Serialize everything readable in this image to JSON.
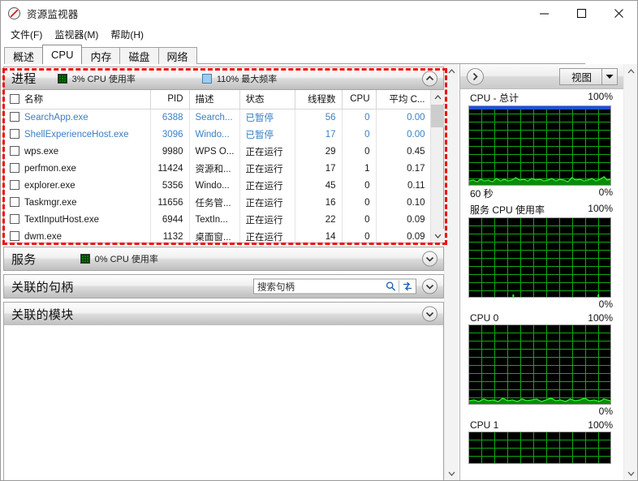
{
  "window": {
    "title": "资源监视器",
    "icon": "resource-monitor-icon",
    "minimize": "—",
    "maximize": "□",
    "close": "✕"
  },
  "menubar": {
    "items": [
      {
        "label": "文件(F)"
      },
      {
        "label": "监视器(M)"
      },
      {
        "label": "帮助(H)"
      }
    ]
  },
  "tabs": [
    {
      "label": "概述",
      "active": false
    },
    {
      "label": "CPU",
      "active": true
    },
    {
      "label": "内存",
      "active": false
    },
    {
      "label": "磁盘",
      "active": false
    },
    {
      "label": "网络",
      "active": false
    }
  ],
  "process_section": {
    "title": "进程",
    "legend_cpu": "3% CPU 使用率",
    "legend_freq": "110% 最大频率",
    "collapse_icon": "chevron-up-icon",
    "columns": [
      {
        "key": "name",
        "label": "名称",
        "align": "left"
      },
      {
        "key": "pid",
        "label": "PID",
        "align": "right"
      },
      {
        "key": "desc",
        "label": "描述",
        "align": "left"
      },
      {
        "key": "status",
        "label": "状态",
        "align": "left",
        "sorted": true,
        "sort_dir": "asc"
      },
      {
        "key": "threads",
        "label": "线程数",
        "align": "right"
      },
      {
        "key": "cpu",
        "label": "CPU",
        "align": "right"
      },
      {
        "key": "avgcpu",
        "label": "平均 C...",
        "align": "right"
      }
    ],
    "rows": [
      {
        "name": "SearchApp.exe",
        "pid": "6388",
        "desc": "Search...",
        "status": "已暂停",
        "threads": "56",
        "cpu": "0",
        "avgcpu": "0.00",
        "suspended": true
      },
      {
        "name": "ShellExperienceHost.exe",
        "pid": "3096",
        "desc": "Windo...",
        "status": "已暂停",
        "threads": "17",
        "cpu": "0",
        "avgcpu": "0.00",
        "suspended": true
      },
      {
        "name": "wps.exe",
        "pid": "9980",
        "desc": "WPS O...",
        "status": "正在运行",
        "threads": "29",
        "cpu": "0",
        "avgcpu": "0.45",
        "suspended": false
      },
      {
        "name": "perfmon.exe",
        "pid": "11424",
        "desc": "资源和...",
        "status": "正在运行",
        "threads": "17",
        "cpu": "1",
        "avgcpu": "0.17",
        "suspended": false
      },
      {
        "name": "explorer.exe",
        "pid": "5356",
        "desc": "Windo...",
        "status": "正在运行",
        "threads": "45",
        "cpu": "0",
        "avgcpu": "0.11",
        "suspended": false
      },
      {
        "name": "Taskmgr.exe",
        "pid": "11656",
        "desc": "任务管...",
        "status": "正在运行",
        "threads": "16",
        "cpu": "0",
        "avgcpu": "0.10",
        "suspended": false
      },
      {
        "name": "TextInputHost.exe",
        "pid": "6944",
        "desc": "TextIn...",
        "status": "正在运行",
        "threads": "22",
        "cpu": "0",
        "avgcpu": "0.09",
        "suspended": false
      },
      {
        "name": "dwm.exe",
        "pid": "1132",
        "desc": "桌面窗...",
        "status": "正在运行",
        "threads": "14",
        "cpu": "0",
        "avgcpu": "0.09",
        "suspended": false
      }
    ]
  },
  "services_section": {
    "title": "服务",
    "legend_cpu": "0% CPU 使用率",
    "expand_icon": "chevron-down-icon"
  },
  "handles_section": {
    "title": "关联的句柄",
    "search_placeholder": "搜索句柄",
    "search_value": "",
    "search_icon": "magnifier-icon",
    "refresh_icon": "refresh-arrows-icon",
    "expand_icon": "chevron-down-icon"
  },
  "modules_section": {
    "title": "关联的模块",
    "expand_icon": "chevron-down-icon"
  },
  "right_panel": {
    "expand_icon": "chevron-right-icon",
    "view_label": "视图",
    "view_dropdown_icon": "chevron-down-filled-icon",
    "graphs": [
      {
        "title": "CPU - 总计",
        "max": "100%",
        "min": "0%",
        "bottom_left": "60 秒",
        "has_blue_line": true,
        "activity": "low"
      },
      {
        "title": "服务 CPU 使用率",
        "max": "100%",
        "min": "0%",
        "bottom_left": "",
        "has_blue_line": false,
        "activity": "flat"
      },
      {
        "title": "CPU 0",
        "max": "100%",
        "min": "0%",
        "bottom_left": "",
        "has_blue_line": false,
        "activity": "low"
      },
      {
        "title": "CPU 1",
        "max": "100%",
        "min": "",
        "bottom_left": "",
        "has_blue_line": false,
        "activity": "low"
      }
    ]
  },
  "colors": {
    "highlight_box": "#ee1111",
    "suspended_text": "#3b7fc4",
    "graph_grid": "#11b411",
    "graph_bg": "#000000",
    "graph_blue": "#1c51d8",
    "legend_green": "#0b7a0b",
    "legend_blue": "#9ccdf0"
  }
}
